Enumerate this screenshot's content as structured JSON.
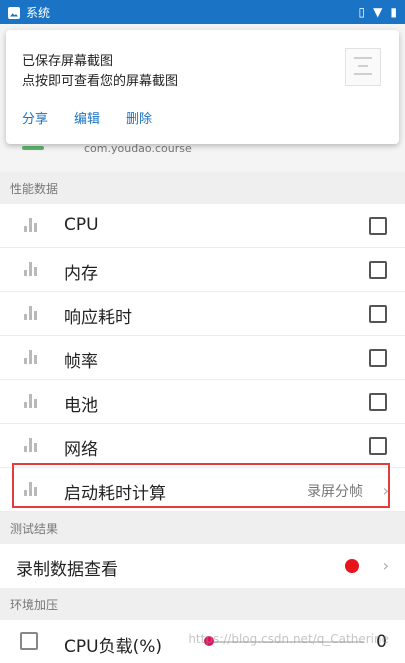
{
  "status_bar": {
    "app_label": "系统"
  },
  "notification": {
    "title": "已保存屏幕截图",
    "subtitle": "点按即可查看您的屏幕截图",
    "actions": [
      "分享",
      "编辑",
      "删除"
    ]
  },
  "app": {
    "package_partial": "com.youdao.course"
  },
  "sections": {
    "performance": "性能数据",
    "test_results": "测试结果",
    "env_pressure": "环境加压"
  },
  "performance_items": [
    {
      "label": "CPU"
    },
    {
      "label": "内存"
    },
    {
      "label": "响应耗时"
    },
    {
      "label": "帧率"
    },
    {
      "label": "电池"
    },
    {
      "label": "网络"
    }
  ],
  "startup_item": {
    "label": "启动耗时计算",
    "value": "录屏分帧"
  },
  "record_item": {
    "label": "录制数据查看"
  },
  "cpu_load": {
    "label": "CPU负载(%)",
    "value": "0"
  },
  "watermark": "https://blog.csdn.net/q_Catherine",
  "colors": {
    "status_bar": "#1a73c4",
    "highlight": "#e23c3c",
    "record_dot": "#e8141b",
    "slider_thumb": "#e0115f"
  }
}
